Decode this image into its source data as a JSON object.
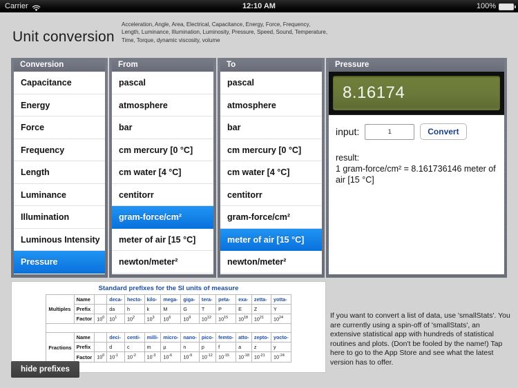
{
  "status_bar": {
    "carrier": "Carrier",
    "wifi_icon": "wifi-icon",
    "time": "12:10 AM",
    "battery_percent": "100%",
    "battery_icon": "battery-icon"
  },
  "header": {
    "title": "Unit conversion",
    "subtitle": "Acceleration, Angle, Area, Electrical, Capacitance, Energy, Force, Frequency, Length, Luminance, Illumination, Luminosity, Pressure, Speed, Sound, Temperature, Time, Torque, dynamic viscosity, volume"
  },
  "colors": {
    "accent_blue": "#2094f3",
    "selected_gradient_end": "#0a72dc",
    "panel_gray": "#6e7280",
    "app_background": "#d3d3d3",
    "lcd_green": "#6a783a",
    "link_blue": "#1f4fa8",
    "convert_text": "#1b3f8f"
  },
  "conversion_list": {
    "header": "Conversion",
    "items": [
      {
        "label": "Capacitance",
        "selected": false
      },
      {
        "label": "Energy",
        "selected": false
      },
      {
        "label": "Force",
        "selected": false
      },
      {
        "label": "Frequency",
        "selected": false
      },
      {
        "label": "Length",
        "selected": false
      },
      {
        "label": "Luminance",
        "selected": false
      },
      {
        "label": "Illumination",
        "selected": false
      },
      {
        "label": "Luminous Intensity",
        "selected": false
      },
      {
        "label": "Pressure",
        "selected": true
      }
    ]
  },
  "from_list": {
    "header": "From",
    "items": [
      {
        "label": "pascal",
        "selected": false
      },
      {
        "label": "atmosphere",
        "selected": false
      },
      {
        "label": "bar",
        "selected": false
      },
      {
        "label": "cm mercury [0 °C]",
        "selected": false
      },
      {
        "label": "cm water [4 °C]",
        "selected": false
      },
      {
        "label": "centitorr",
        "selected": false
      },
      {
        "label": "gram-force/cm²",
        "selected": true
      },
      {
        "label": "meter of air [15 °C]",
        "selected": false
      },
      {
        "label": "newton/meter²",
        "selected": false
      }
    ]
  },
  "to_list": {
    "header": "To",
    "items": [
      {
        "label": "pascal",
        "selected": false
      },
      {
        "label": "atmosphere",
        "selected": false
      },
      {
        "label": "bar",
        "selected": false
      },
      {
        "label": "cm mercury [0 °C]",
        "selected": false
      },
      {
        "label": "cm water [4 °C]",
        "selected": false
      },
      {
        "label": "centitorr",
        "selected": false
      },
      {
        "label": "gram-force/cm²",
        "selected": false
      },
      {
        "label": "meter of air [15 °C]",
        "selected": true
      },
      {
        "label": "newton/meter²",
        "selected": false
      }
    ]
  },
  "result_panel": {
    "header": "Pressure",
    "lcd_value": "8.16174",
    "input_label": "input:",
    "input_value": "1",
    "input_placeholder": "1",
    "convert_label": "Convert",
    "result_label": "result:",
    "result_text": "1 gram-force/cm² = 8.161736146 meter of air [15 °C]"
  },
  "prefix_table": {
    "title": "Standard prefixes for the SI units of measure",
    "multiples": {
      "group_label": "Multiples",
      "row_labels": [
        "Name",
        "Prefix",
        "Factor"
      ],
      "names": [
        "deca-",
        "hecto-",
        "kilo-",
        "mega-",
        "giga-",
        "tera-",
        "peta-",
        "exa-",
        "zetta-",
        "yotta-"
      ],
      "prefixes": [
        "da",
        "h",
        "k",
        "M",
        "G",
        "T",
        "P",
        "E",
        "Z",
        "Y"
      ],
      "base_factor": {
        "base": "10",
        "exp": "0"
      },
      "factors": [
        {
          "base": "10",
          "exp": "1"
        },
        {
          "base": "10",
          "exp": "2"
        },
        {
          "base": "10",
          "exp": "3"
        },
        {
          "base": "10",
          "exp": "6"
        },
        {
          "base": "10",
          "exp": "9"
        },
        {
          "base": "10",
          "exp": "12"
        },
        {
          "base": "10",
          "exp": "15"
        },
        {
          "base": "10",
          "exp": "18"
        },
        {
          "base": "10",
          "exp": "21"
        },
        {
          "base": "10",
          "exp": "24"
        }
      ]
    },
    "fractions": {
      "group_label": "Fractions",
      "row_labels": [
        "Name",
        "Prefix",
        "Factor"
      ],
      "names": [
        "deci-",
        "centi-",
        "milli-",
        "micro-",
        "nano-",
        "pico-",
        "femto-",
        "atto-",
        "zepto-",
        "yocto-"
      ],
      "prefixes": [
        "d",
        "c",
        "m",
        "µ",
        "n",
        "p",
        "f",
        "a",
        "z",
        "y"
      ],
      "base_factor": {
        "base": "10",
        "exp": "0"
      },
      "factors": [
        {
          "base": "10",
          "exp": "-1"
        },
        {
          "base": "10",
          "exp": "-2"
        },
        {
          "base": "10",
          "exp": "-3"
        },
        {
          "base": "10",
          "exp": "-6"
        },
        {
          "base": "10",
          "exp": "-9"
        },
        {
          "base": "10",
          "exp": "-12"
        },
        {
          "base": "10",
          "exp": "-15"
        },
        {
          "base": "10",
          "exp": "-18"
        },
        {
          "base": "10",
          "exp": "-21"
        },
        {
          "base": "10",
          "exp": "-24"
        }
      ]
    }
  },
  "promo": {
    "text": "If you want to convert a list of data, use 'smallStats'. You are currently using a spin-off of 'smallStats', an extensive statistical app with hundreds of statistical routines and plots. (Don't be fooled by the name!) Tap here to go to the App Store and see what the latest version has to offer."
  },
  "hide_prefixes_button": {
    "label": "hide prefixes"
  }
}
